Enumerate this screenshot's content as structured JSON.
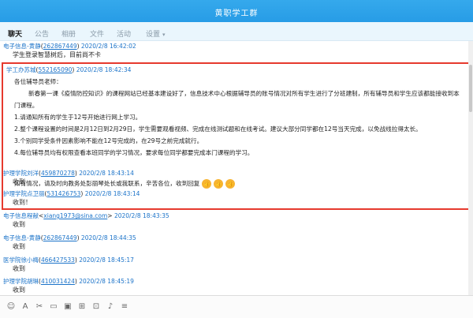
{
  "window": {
    "title": "黄职学工群"
  },
  "tabs": [
    {
      "label": "聊天"
    },
    {
      "label": "公告"
    },
    {
      "label": "相册"
    },
    {
      "label": "文件"
    },
    {
      "label": "活动"
    },
    {
      "label": "设置"
    }
  ],
  "messages_top": [
    {
      "sender": "电子信息-黄静",
      "qq": "262867449",
      "time": "2020/2/8 16:42:02",
      "text": "学生登录智慧树后，目前尚不卡"
    }
  ],
  "highlighted": {
    "sender": "学工办苏城",
    "qq": "552165090",
    "time": "2020/2/8 18:42:34",
    "lines": [
      "各位辅导员老师：",
      "新春第一课《疫情防控知识》的课程网站已经基本建设好了，信息技术中心根据辅导员的账号情况对所有学生进行了分班建制，所有辅导员和学生应该都能接收到本",
      "门课程。",
      "1.请通知所有的学生于12号开始进行网上学习。",
      "2.整个课程设置的时间是2月12日到2月29日，学生需要观看视频、完成在线测试题和在线考试。建议大部分同学都在12号当天完成，以免战线拉得太长。",
      "3.个别同学受条件因素影响不能在12号完成的，在29号之前完成就行。",
      "4.每位辅导员均有权限查看本班同学的学习情况，要求每位同学都要完成本门课程的学习。",
      "如有情况，请及时向教务处彭丽琴处长或我联系，辛苦各位，收到回复"
    ]
  },
  "messages": [
    {
      "sender": "护理学院刘洋",
      "qq": "459870278",
      "time": "2020/2/8 18:43:14",
      "text": "收到"
    },
    {
      "sender": "护理学院点卫丽",
      "qq": "531426753",
      "time": "2020/2/8 18:43:14",
      "text": "收到！"
    },
    {
      "sender": "电子信息程献",
      "qq": "xiang1973@sina.com",
      "time": "2020/2/8 18:43:35",
      "text": "收到"
    },
    {
      "sender": "电子信息-黄静",
      "qq": "262867449",
      "time": "2020/2/8 18:44:35",
      "text": "收到"
    },
    {
      "sender": "医学院徐小梅",
      "qq": "466427533",
      "time": "2020/2/8 18:45:17",
      "text": "收到"
    },
    {
      "sender": "护理学院胡琳",
      "qq": "410031424",
      "time": "2020/2/8 18:45:19",
      "text": "收到"
    }
  ],
  "toolbar_icons": [
    "emoji-icon",
    "font-icon",
    "scissors-icon",
    "folder-icon",
    "image-icon",
    "gift-icon",
    "screenshot-icon",
    "voice-icon",
    "history-icon"
  ]
}
